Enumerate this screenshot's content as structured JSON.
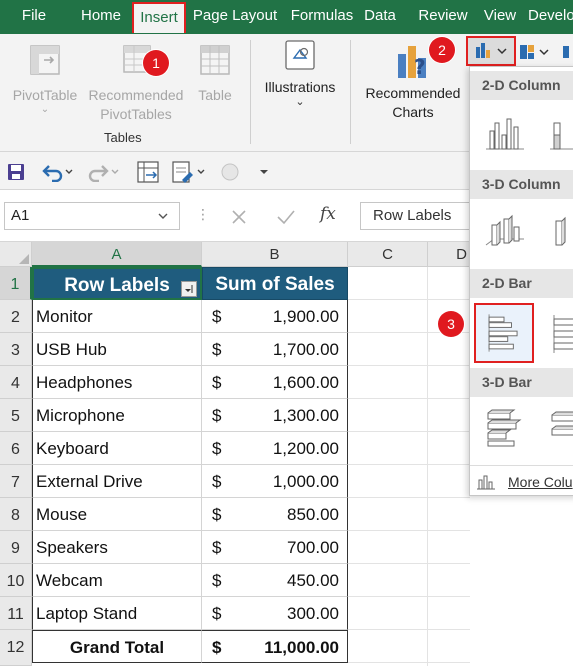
{
  "menu": {
    "tabs": [
      "File",
      "Home",
      "Insert",
      "Page Layout",
      "Formulas",
      "Data",
      "Review",
      "View",
      "Develo"
    ],
    "active": "Insert"
  },
  "ribbon": {
    "pivot_label": "PivotTable",
    "rec_pivot_line1": "Recommended",
    "rec_pivot_line2": "PivotTables",
    "table_label": "Table",
    "tables_group": "Tables",
    "illustrations_label": "Illustrations",
    "rec_charts_line1": "Recommended",
    "rec_charts_line2": "Charts"
  },
  "badges": [
    "1",
    "2",
    "3"
  ],
  "formula": {
    "name_box": "A1",
    "fx_label": "fx",
    "content": "Row Labels"
  },
  "grid": {
    "columns": [
      "A",
      "B",
      "C",
      "D"
    ],
    "rows": [
      "1",
      "2",
      "3",
      "4",
      "5",
      "6",
      "7",
      "8",
      "9",
      "10",
      "11",
      "12"
    ],
    "header_a": "Row Labels",
    "header_b": "Sum of Sales",
    "currency": "$",
    "data": [
      {
        "label": "Monitor",
        "value": "1,900.00"
      },
      {
        "label": "USB Hub",
        "value": "1,700.00"
      },
      {
        "label": "Headphones",
        "value": "1,600.00"
      },
      {
        "label": "Microphone",
        "value": "1,300.00"
      },
      {
        "label": "Keyboard",
        "value": "1,200.00"
      },
      {
        "label": "External Drive",
        "value": "1,000.00"
      },
      {
        "label": "Mouse",
        "value": "850.00"
      },
      {
        "label": "Speakers",
        "value": "700.00"
      },
      {
        "label": "Webcam",
        "value": "450.00"
      },
      {
        "label": "Laptop Stand",
        "value": "300.00"
      }
    ],
    "total_label": "Grand Total",
    "total_value": "11,000.00"
  },
  "dropdown": {
    "sections": [
      "2-D Column",
      "3-D Column",
      "2-D Bar",
      "3-D Bar"
    ],
    "more": "More Colu"
  },
  "colors": {
    "excel_green": "#217346",
    "header_blue": "#1f5c7e",
    "badge_red": "#e0191f"
  }
}
